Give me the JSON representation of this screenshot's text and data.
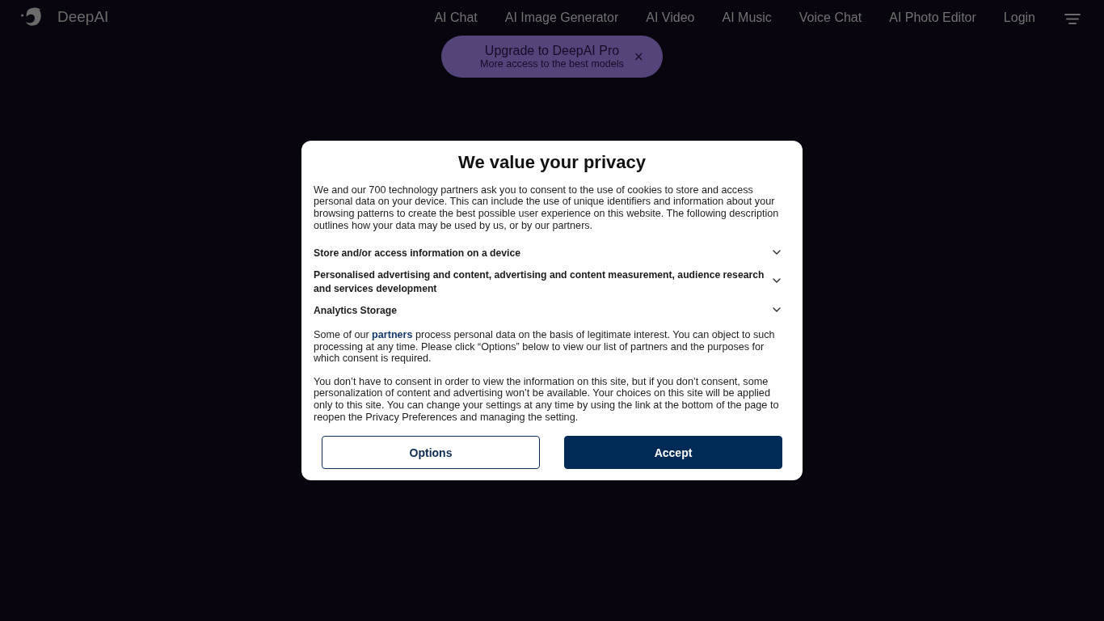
{
  "header": {
    "site_name": "DeepAI",
    "nav": [
      "AI Chat",
      "AI Image Generator",
      "AI Video",
      "AI Music",
      "Voice Chat",
      "AI Photo Editor"
    ],
    "login": "Login"
  },
  "promo": {
    "title": "Upgrade to DeepAI Pro",
    "subtitle": "More access to the best models",
    "close": "×"
  },
  "consent_dialog": {
    "title": "We value your privacy",
    "intro": "We and our 700 technology partners ask you to consent to the use of cookies to store and access personal data on your device. This can include the use of unique identifiers and information about your browsing patterns to create the best possible user experience on this website. The following description outlines how your data may be used by us, or by our partners.",
    "purposes": [
      {
        "label": "Store and/or access information on a device",
        "expanded": false
      },
      {
        "label": "Personalised advertising and content, advertising and content measurement, audience research and services development",
        "expanded": false
      },
      {
        "label": "Analytics Storage",
        "expanded": false
      }
    ],
    "notice": {
      "before": "Some of our ",
      "link": "partners",
      "after": " process personal data on the basis of legitimate interest. You can object to such processing at any time. Please click “Options” below to view our list of partners and the purposes for which consent is required."
    },
    "disclaimer": "You don’t have to consent in order to view the information on this site, but if you don’t consent, some personalization of content and advertising won’t be available. Your choices on this site will be applied only to this site. You can change your settings at any time by using the link at the bottom of the page to reopen the Privacy Preferences and managing the setting.",
    "buttons": [
      {
        "label": "Options",
        "kind": "secondary"
      },
      {
        "label": "Accept",
        "kind": "primary"
      }
    ]
  }
}
